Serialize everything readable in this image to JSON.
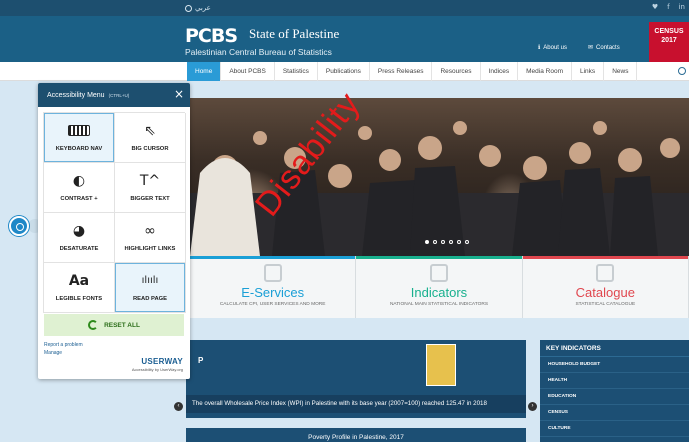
{
  "topbar": {
    "language": "عربي",
    "social": [
      "♥",
      "f",
      "in"
    ]
  },
  "header": {
    "logo_mark": "PCBS",
    "title": "State of Palestine",
    "subtitle": "Palestinian Central Bureau of Statistics",
    "about_us": "About us",
    "contacts": "Contacts",
    "census_label": "CENSUS",
    "census_year": "2017"
  },
  "nav": {
    "items": [
      "Home",
      "About PCBS",
      "Statistics",
      "Publications",
      "Press Releases",
      "Resources",
      "Indices",
      "Media Room",
      "Links",
      "News"
    ]
  },
  "services": [
    {
      "name": "E-Services",
      "desc": "CALCULATE CPI, USER SERVICES AND MORE",
      "color": "#1a9fd6"
    },
    {
      "name": "Indicators",
      "desc": "NATIONAL MAIN STATISTICAL INDICATORS",
      "color": "#18b08e"
    },
    {
      "name": "Catalogue",
      "desc": "STATISTICAL CATALOGUE",
      "color": "#e0474f"
    }
  ],
  "news": {
    "letter": "P",
    "headline": "The overall Wholesale Price Index (WPI) in Palestine with its base year (2007=100) reached 125.47 in 2018",
    "next_title": "Poverty Profile in Palestine, 2017"
  },
  "key_indicators": {
    "title": "KEY INDICATORS",
    "rows": [
      "HOUSEHOLD BUDGET",
      "HEALTH",
      "EDUCATION",
      "CENSUS",
      "CULTURE"
    ]
  },
  "watermark": "Disability",
  "accessibility": {
    "title": "Accessibility Menu",
    "shortcut": "(CTRL+U)",
    "close": "×",
    "tiles": [
      {
        "label": "KEYBOARD NAV",
        "icon": "keyboard-icon",
        "glyph": "",
        "selected": true
      },
      {
        "label": "BIG CURSOR",
        "icon": "cursor-icon",
        "glyph": "⇖",
        "selected": false
      },
      {
        "label": "CONTRAST +",
        "icon": "contrast-icon",
        "glyph": "◐",
        "selected": false
      },
      {
        "label": "BIGGER TEXT",
        "icon": "text-size-icon",
        "glyph": "T^",
        "selected": false
      },
      {
        "label": "DESATURATE",
        "icon": "desaturate-icon",
        "glyph": "◕",
        "selected": false
      },
      {
        "label": "HIGHLIGHT LINKS",
        "icon": "link-icon",
        "glyph": "∞",
        "selected": false
      },
      {
        "label": "LEGIBLE FONTS",
        "icon": "font-icon",
        "glyph": "Aa",
        "selected": false
      },
      {
        "label": "READ PAGE",
        "icon": "audio-wave-icon",
        "glyph": "ılıılı",
        "selected": true
      }
    ],
    "reset": "RESET ALL",
    "report": "Report a problem",
    "manage": "Manage",
    "brand": "USERWAY",
    "brand_sub": "Accessibility by UserWay.org"
  }
}
